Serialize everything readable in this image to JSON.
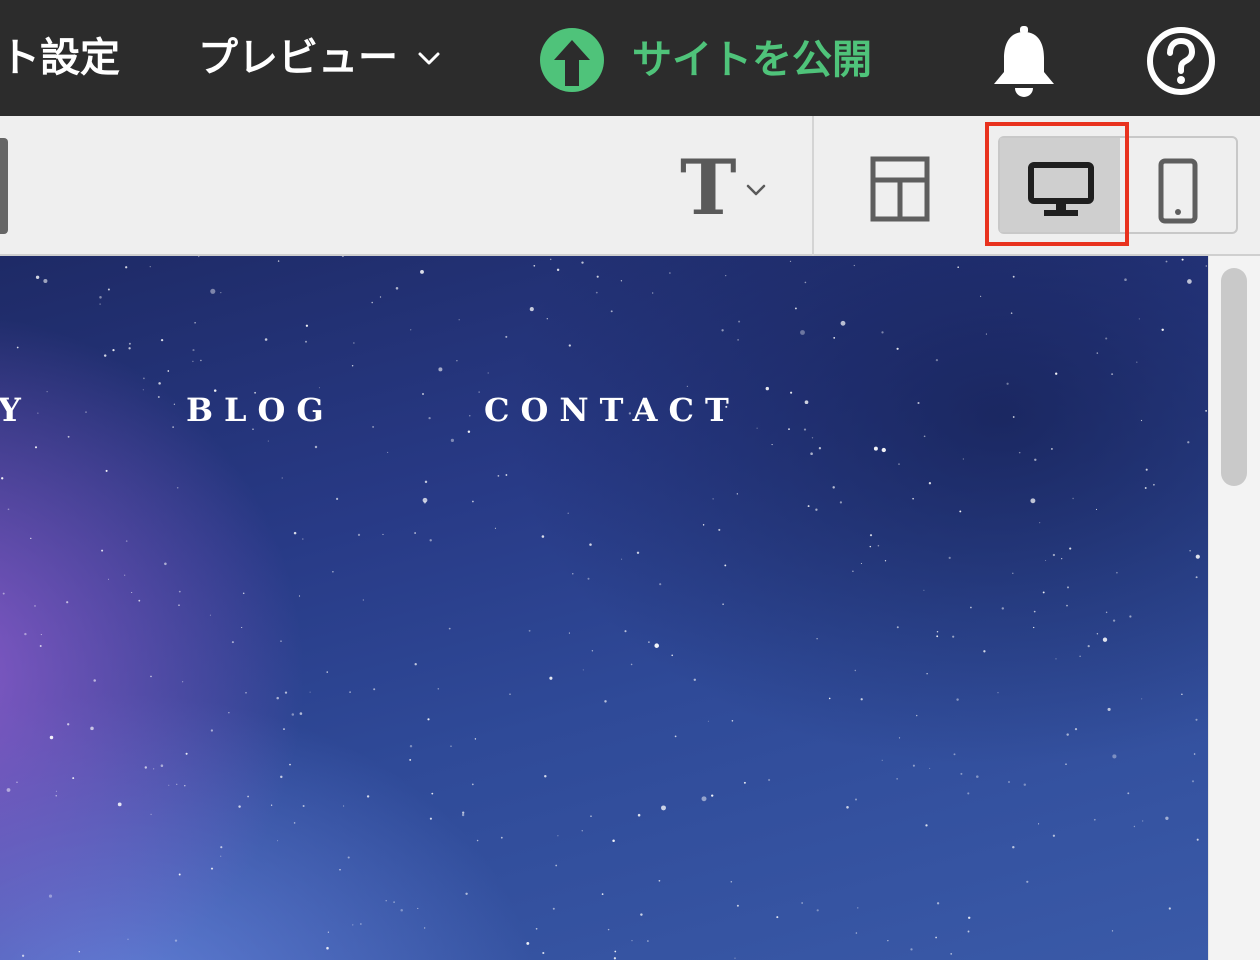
{
  "topbar": {
    "site_settings_label": "ト設定",
    "preview_label": "プレビュー",
    "publish_label": "サイトを公開",
    "publish_color": "#4fc37a",
    "icons": [
      "chevron-down-icon",
      "upload-arrow-icon",
      "bell-icon",
      "help-icon"
    ]
  },
  "toolbar": {
    "text_tool_glyph": "T",
    "icons": [
      "text-style-icon",
      "layout-icon",
      "desktop-icon",
      "mobile-icon"
    ],
    "selected_device": "desktop",
    "highlight_color": "#e8321e"
  },
  "site_nav": {
    "partial_item": "Y",
    "blog": "BLOG",
    "contact": "CONTACT"
  }
}
